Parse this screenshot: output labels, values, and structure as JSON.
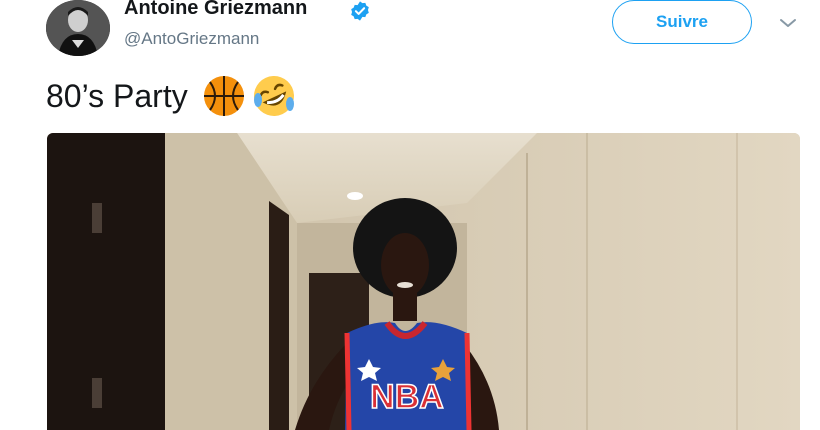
{
  "tweet": {
    "author": {
      "display_name": "Antoine Griezmann",
      "handle": "@AntoGriezmann",
      "verified": true,
      "avatar_icon": "person-avatar"
    },
    "follow_label": "Suivre",
    "menu_icon": "chevron-down-icon",
    "text": "80’s Party",
    "emojis": [
      "basketball-emoji",
      "rolling-on-floor-laughing-emoji"
    ],
    "media": {
      "type": "photo",
      "jersey_text": "NBA"
    }
  },
  "colors": {
    "brand_blue": "#1da1f2",
    "text_primary": "#14171a",
    "text_secondary": "#657786"
  }
}
